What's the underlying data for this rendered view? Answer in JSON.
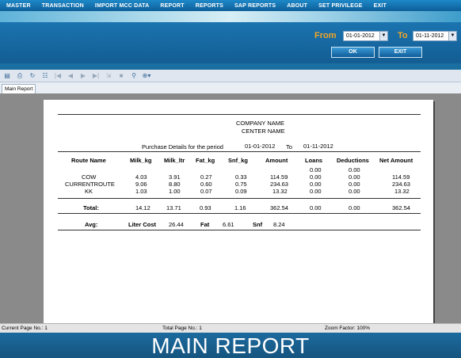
{
  "menu": [
    "MASTER",
    "TRANSACTION",
    "IMPORT MCC DATA",
    "REPORT",
    "REPORTS",
    "SAP REPORTS",
    "ABOUT",
    "SET PRIVILEGE",
    "EXIT"
  ],
  "filter": {
    "from_label": "From",
    "from_value": "01-01-2012",
    "to_label": "To",
    "to_value": "01-11-2012",
    "ok_label": "OK",
    "exit_label": "EXIT"
  },
  "toolbar_icons": [
    "export-icon",
    "print-icon",
    "refresh-icon",
    "tree-icon",
    "first-page-icon",
    "prev-page-icon",
    "next-page-icon",
    "last-page-icon",
    "goto-page-icon",
    "stop-icon",
    "search-icon",
    "zoom-icon"
  ],
  "tab": "Main Report",
  "report": {
    "company": "COMPANY NAME",
    "center": "CENTER NAME",
    "period_label": "Purchase Details for the period",
    "period_from": "01-01-2012",
    "period_to_label": "To",
    "period_to": "01-11-2012",
    "columns": [
      "Route  Name",
      "Milk_kg",
      "Milk_ltr",
      "Fat_kg",
      "Snf_kg",
      "Amount",
      "Loans",
      "Deductions",
      "Net Amount"
    ],
    "extra_row": {
      "loans": "0.00",
      "deductions": "0.00"
    },
    "rows": [
      {
        "name": "COW",
        "milk_kg": "4.03",
        "milk_ltr": "3.91",
        "fat_kg": "0.27",
        "snf_kg": "0.33",
        "amount": "114.59",
        "loans": "0.00",
        "deductions": "0.00",
        "net": "114.59"
      },
      {
        "name": "CURRENTROUTE",
        "milk_kg": "9.06",
        "milk_ltr": "8.80",
        "fat_kg": "0.60",
        "snf_kg": "0.75",
        "amount": "234.63",
        "loans": "0.00",
        "deductions": "0.00",
        "net": "234.63"
      },
      {
        "name": "KK",
        "milk_kg": "1.03",
        "milk_ltr": "1.00",
        "fat_kg": "0.07",
        "snf_kg": "0.09",
        "amount": "13.32",
        "loans": "0.00",
        "deductions": "0.00",
        "net": "13.32"
      }
    ],
    "total": {
      "label": "Total:",
      "milk_kg": "14.12",
      "milk_ltr": "13.71",
      "fat_kg": "0.93",
      "snf_kg": "1.16",
      "amount": "362.54",
      "loans": "0.00",
      "deductions": "0.00",
      "net": "362.54"
    },
    "avg": {
      "label": "Avg:",
      "liter_cost_label": "Liter Cost",
      "liter_cost": "26.44",
      "fat_label": "Fat",
      "fat": "6.61",
      "snf_label": "Snf",
      "snf": "8.24"
    }
  },
  "status": {
    "current_page": "Current Page No.: 1",
    "total_page": "Total Page No.: 1",
    "zoom": "Zoom Factor: 100%"
  },
  "caption": "MAIN REPORT"
}
